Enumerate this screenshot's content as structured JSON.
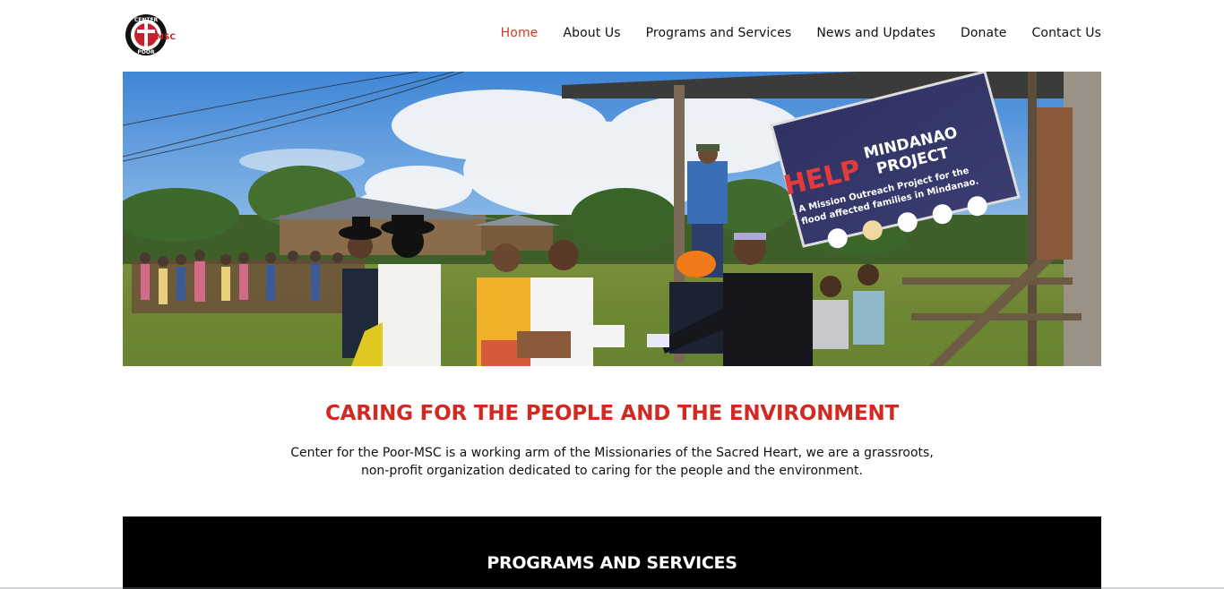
{
  "header": {
    "logo": {
      "name": "center-for-the-poor-msc-logo",
      "text_top": "CENTER",
      "text_bottom": "POOR",
      "text_side": "MSC"
    },
    "nav": [
      {
        "label": "Home",
        "active": true
      },
      {
        "label": "About Us",
        "active": false
      },
      {
        "label": "Programs and Services",
        "active": false
      },
      {
        "label": "News and Updates",
        "active": false
      },
      {
        "label": "Donate",
        "active": false
      },
      {
        "label": "Contact Us",
        "active": false
      }
    ]
  },
  "hero": {
    "banner_line1": "HELP",
    "banner_line2": "MINDANAO",
    "banner_line3": "PROJECT",
    "banner_sub1": "A Mission Outreach Project for the",
    "banner_sub2": "flood affected families in Mindanao."
  },
  "intro": {
    "title": "CARING FOR THE PEOPLE AND THE ENVIRONMENT",
    "line1": "Center for the Poor-MSC is a working arm of the Missionaries of the Sacred Heart, we are a grassroots,",
    "line2": "non-profit organization dedicated to caring for the people and the environment."
  },
  "programs": {
    "title": "PROGRAMS AND SERVICES"
  },
  "colors": {
    "accent": "#d23a2a",
    "title_red": "#d02a22",
    "band": "#000000"
  }
}
